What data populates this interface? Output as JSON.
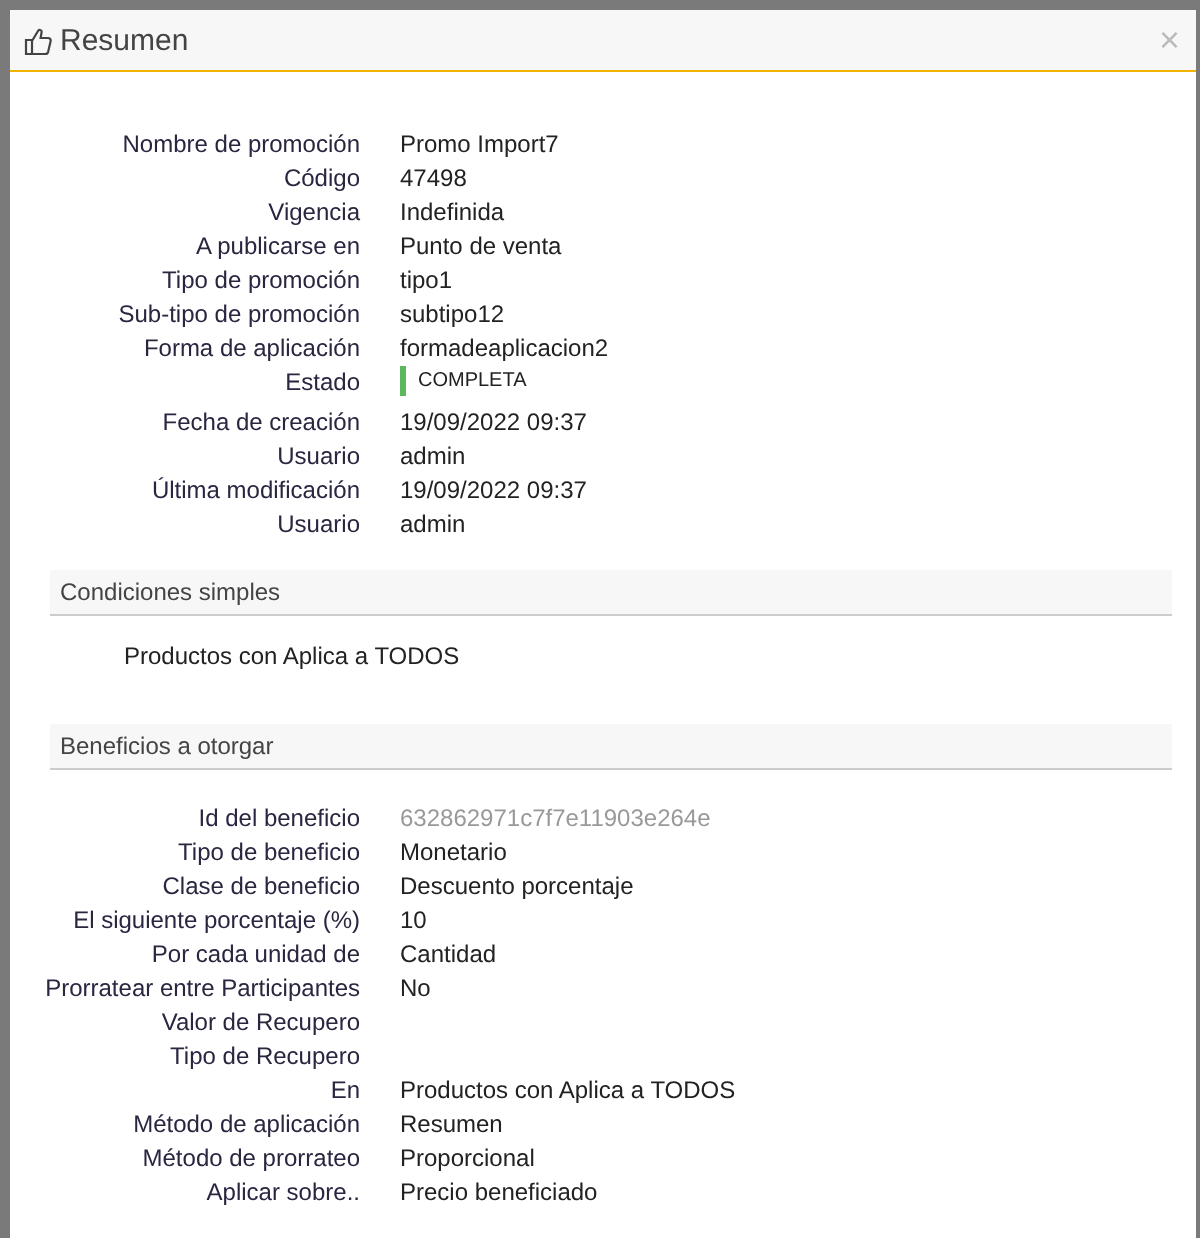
{
  "dialog": {
    "title": "Resumen",
    "close": "×"
  },
  "details": [
    {
      "label": "Nombre de promoción",
      "value": "Promo Import7"
    },
    {
      "label": "Código",
      "value": "47498"
    },
    {
      "label": "Vigencia",
      "value": "Indefinida"
    },
    {
      "label": "A publicarse en",
      "value": "Punto de venta"
    },
    {
      "label": "Tipo de promoción",
      "value": "tipo1"
    },
    {
      "label": "Sub-tipo de promoción",
      "value": "subtipo12"
    },
    {
      "label": "Forma de aplicación",
      "value": "formadeaplicacion2"
    },
    {
      "label": "Estado",
      "value": "COMPLETA",
      "kind": "status",
      "color": "#5cb85c"
    },
    {
      "label": "Fecha de creación",
      "value": "19/09/2022 09:37"
    },
    {
      "label": "Usuario",
      "value": "admin"
    },
    {
      "label": "Última modificación",
      "value": "19/09/2022 09:37"
    },
    {
      "label": "Usuario",
      "value": "admin"
    }
  ],
  "sections": [
    {
      "title": "Condiciones simples",
      "text": "Productos con Aplica a TODOS"
    },
    {
      "title": "Beneficios a otorgar",
      "rows": [
        {
          "label": "Id del beneficio",
          "value": "632862971c7f7e11903e264e",
          "kind": "muted"
        },
        {
          "label": "Tipo de beneficio",
          "value": "Monetario"
        },
        {
          "label": "Clase de beneficio",
          "value": "Descuento porcentaje"
        },
        {
          "label": "El siguiente porcentaje (%)",
          "value": "10"
        },
        {
          "label": "Por cada unidad de",
          "value": "Cantidad"
        },
        {
          "label": "Prorratear entre Participantes",
          "value": "No"
        },
        {
          "label": "Valor de Recupero"
        },
        {
          "label": "Tipo de Recupero"
        },
        {
          "label": "En",
          "value": "Productos con Aplica a TODOS"
        },
        {
          "label": "Método de aplicación",
          "value": "Resumen"
        },
        {
          "label": "Método de prorrateo",
          "value": "Proporcional"
        },
        {
          "label": "Aplicar sobre..",
          "value": "Precio beneficiado"
        }
      ]
    }
  ]
}
